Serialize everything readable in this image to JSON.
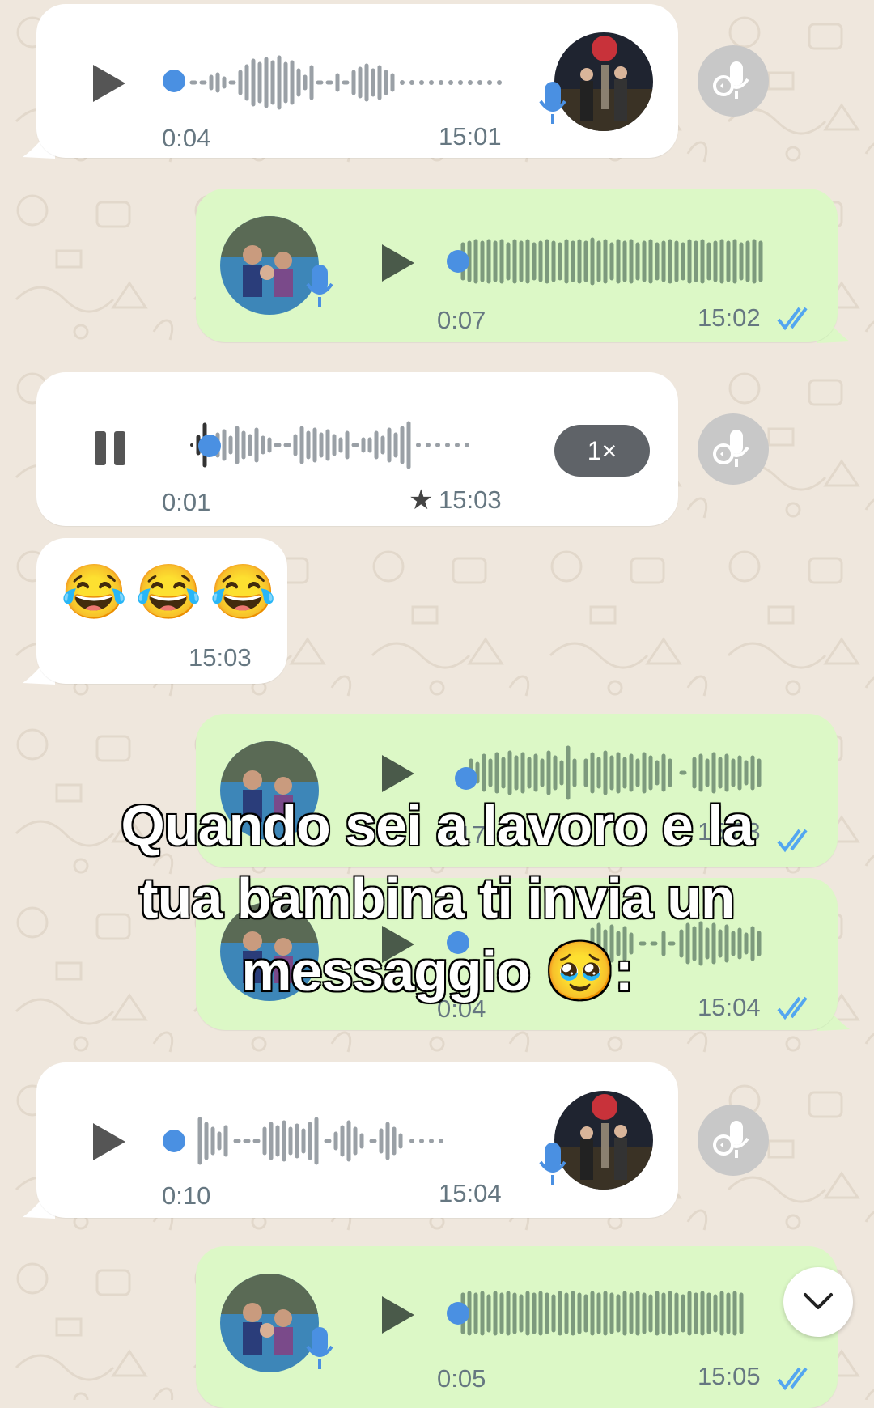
{
  "messages": [
    {
      "direction": "in",
      "state": "play",
      "duration": "0:04",
      "time": "15:01"
    },
    {
      "direction": "out",
      "state": "play",
      "duration": "0:07",
      "time": "15:02"
    },
    {
      "direction": "in",
      "state": "pause",
      "duration": "0:01",
      "time": "15:03",
      "speed": "1×",
      "starred": true
    },
    {
      "direction": "in",
      "type": "text",
      "emoji": "😂😂😂",
      "time": "15:03"
    },
    {
      "direction": "out",
      "state": "play",
      "duration": "0:17",
      "time": "15:03"
    },
    {
      "direction": "out",
      "state": "play",
      "duration": "0:04",
      "time": "15:04"
    },
    {
      "direction": "in",
      "state": "play",
      "duration": "0:10",
      "time": "15:04"
    },
    {
      "direction": "out",
      "state": "play",
      "duration": "0:05",
      "time": "15:05"
    }
  ],
  "caption": {
    "line1": "Quando sei a lavoro e la",
    "line2": "tua bambina ti invia un",
    "line3": "messaggio 🥹:"
  },
  "icons": {
    "play": "play-icon",
    "pause": "pause-icon",
    "mic": "mic-icon",
    "forward": "forward-voice-icon",
    "read": "double-check-icon",
    "chevron": "chevron-down-icon",
    "star": "star-icon"
  },
  "colors": {
    "incoming": "#ffffff",
    "outgoing": "#dcf8c6",
    "accent_dot": "#4a90e2",
    "read_ticks": "#53a6f0",
    "background": "#efe7dd"
  }
}
